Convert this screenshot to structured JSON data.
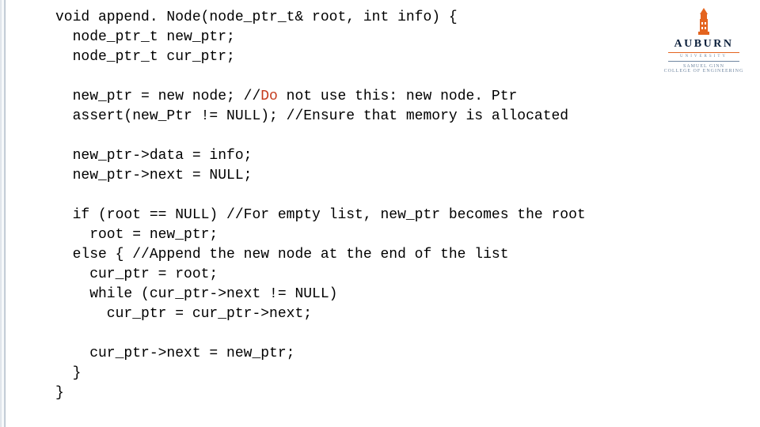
{
  "logo": {
    "wordmark": "AUBURN",
    "university": "UNIVERSITY",
    "college_line1": "SAMUEL GINN",
    "college_line2": "COLLEGE OF ENGINEERING"
  },
  "code": {
    "l1": "void append. Node(node_ptr_t& root, int info) {",
    "l2": "  node_ptr_t new_ptr;",
    "l3": "  node_ptr_t cur_ptr;",
    "l4": "",
    "l5a": "  new_ptr = new node; //",
    "l5b": "Do",
    "l5c": " not use this: new node. Ptr",
    "l6": "  assert(new_Ptr != NULL); //Ensure that memory is allocated",
    "l7": "",
    "l8": "  new_ptr->data = info;",
    "l9": "  new_ptr->next = NULL;",
    "l10": "",
    "l11": "  if (root == NULL) //For empty list, new_ptr becomes the root",
    "l12": "    root = new_ptr;",
    "l13": "  else { //Append the new node at the end of the list",
    "l14": "    cur_ptr = root;",
    "l15": "    while (cur_ptr->next != NULL)",
    "l16": "      cur_ptr = cur_ptr->next;",
    "l17": "",
    "l18": "    cur_ptr->next = new_ptr;",
    "l19": "  }",
    "l20": "}"
  }
}
